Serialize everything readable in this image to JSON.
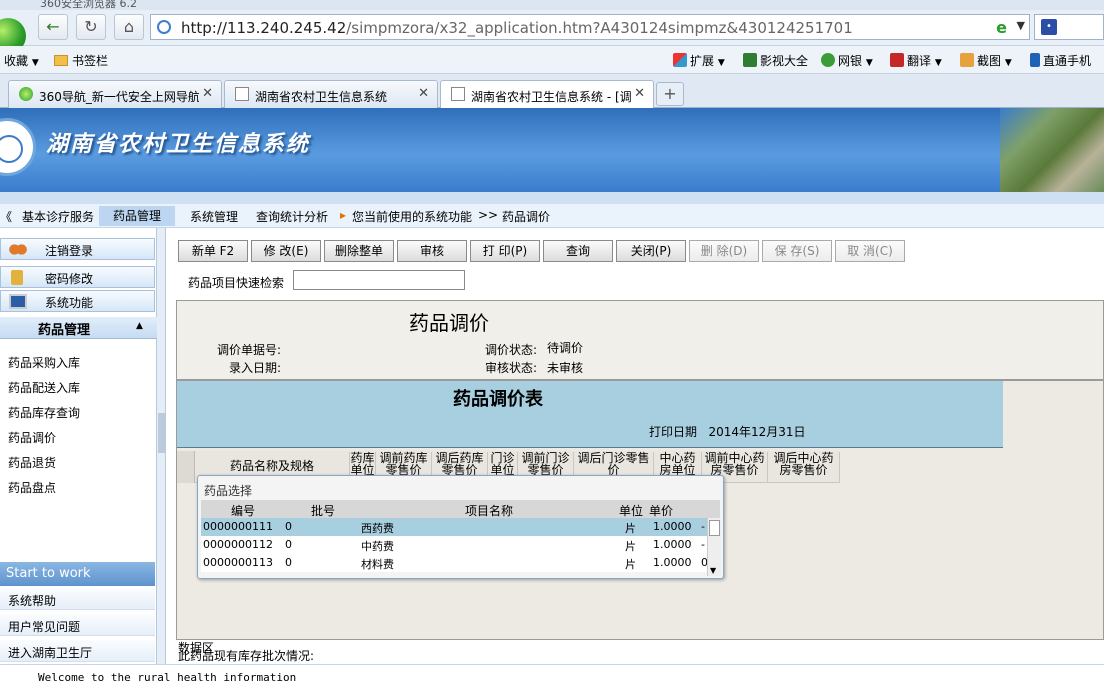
{
  "browser": {
    "title_fragment": "360安全浏览器 6.2",
    "url_host": "http://113.240.245.42",
    "url_path": "/simpmzora/x32_application.htm?A430124simpmz&430124251701",
    "bookmarks": {
      "favorites": "收藏",
      "bar": "书签栏"
    },
    "tools": {
      "extend": "扩展",
      "video": "影视大全",
      "bank": "网银",
      "translate": "翻译",
      "screenshot": "截图",
      "phone": "直通手机"
    },
    "tabs": [
      {
        "label": "360导航_新一代安全上网导航"
      },
      {
        "label": "湖南省农村卫生信息系统"
      },
      {
        "label": "湖南省农村卫生信息系统 - [调"
      }
    ],
    "newtab": "+"
  },
  "banner": {
    "title": "湖南省农村卫生信息系统"
  },
  "appnav": {
    "items": [
      "基本诊疗服务",
      "药品管理",
      "系统管理",
      "查询统计分析"
    ],
    "prefix": "《",
    "current_label": "您当前使用的系统功能",
    "sep": ">>",
    "current": "药品调价"
  },
  "sidebar": {
    "top_items": [
      "注销登录",
      "密码修改",
      "系统功能"
    ],
    "section": "药品管理",
    "links": [
      "药品采购入库",
      "药品配送入库",
      "药品库存查询",
      "药品调价",
      "药品退货",
      "药品盘点"
    ],
    "start": "Start to work",
    "bottom": [
      "系统帮助",
      "用户常见问题",
      "进入湖南卫生厅"
    ]
  },
  "toolbar": {
    "new": "新单 F2",
    "edit": "修  改(E)",
    "delete_all": "删除整单",
    "audit": "审核",
    "print": "打  印(P)",
    "query": "查询",
    "close": "关闭(P)",
    "delete": "删  除(D)",
    "save": "保  存(S)",
    "cancel": "取  消(C)"
  },
  "search": {
    "label": "药品项目快速检索",
    "value": ""
  },
  "form": {
    "title": "药品调价",
    "bill_no_label": "调价单据号:",
    "entry_date_label": "录入日期:",
    "status_label": "调价状态:",
    "status_value": "待调价",
    "audit_label": "审核状态:",
    "audit_value": "未审核"
  },
  "report": {
    "title": "药品调价表",
    "print_date_label": "打印日期",
    "print_date": "2014年12月31日",
    "columns": [
      "药品名称及规格",
      "药库单位",
      "调前药库零售价",
      "调后药库零售价",
      "门诊单位",
      "调前门诊零售价",
      "调后门诊零售价",
      "中心药房单位",
      "调前中心药房零售价",
      "调后中心药房零售价"
    ]
  },
  "popup": {
    "title": "药品选择",
    "headers": [
      "编号",
      "批号",
      "项目名称",
      "单位",
      "单价"
    ],
    "rows": [
      {
        "code": "0000000111",
        "batch": "0",
        "name": "西药费",
        "unit": "片",
        "price": "1.0000",
        "extra": "-"
      },
      {
        "code": "0000000112",
        "batch": "0",
        "name": "中药费",
        "unit": "片",
        "price": "1.0000",
        "extra": "-"
      },
      {
        "code": "0000000113",
        "batch": "0",
        "name": "材料费",
        "unit": "片",
        "price": "1.0000",
        "extra": "0"
      }
    ]
  },
  "footer": {
    "data_area": "数据区",
    "stock": "此药品现有库存批次情况:",
    "status": "Welcome to the rural health information"
  }
}
